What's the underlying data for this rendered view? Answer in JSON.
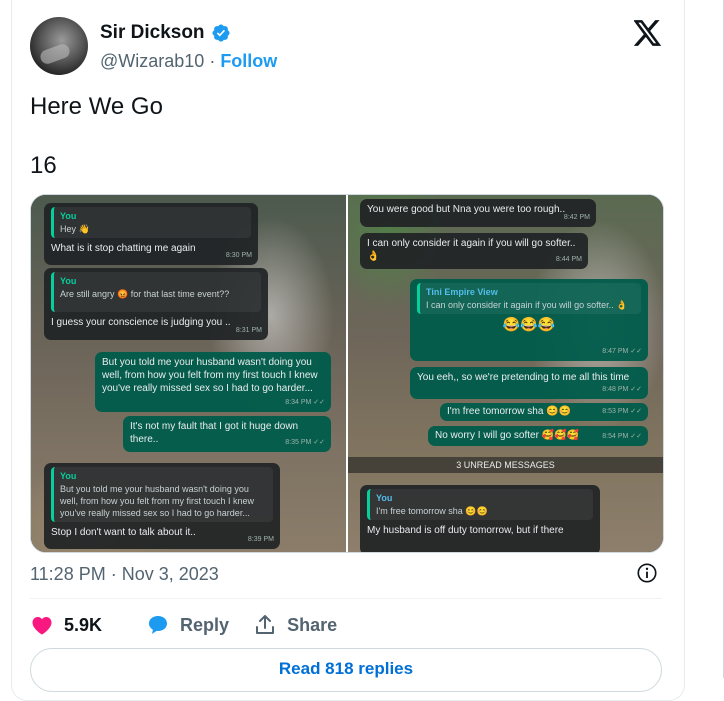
{
  "author": {
    "display_name": "Sir Dickson",
    "handle": "@Wizarab10",
    "separator": " · ",
    "follow_label": "Follow"
  },
  "tweet": {
    "text": "Here We Go",
    "number": "16",
    "timestamp": "11:28 PM · Nov 3, 2023"
  },
  "chat_left": {
    "m1": {
      "quote_name": "You",
      "quote_text": "Hey 👋",
      "text": "What is it stop chatting me again",
      "time": "8:30 PM"
    },
    "m2": {
      "quote_name": "You",
      "quote_text": "Are still angry 😡 for that last time event??",
      "text": "I guess your conscience is judging you ..",
      "time": "8:31 PM"
    },
    "m3": {
      "text": "But you told me your husband wasn't doing you well, from how you felt from my first touch I knew you've really missed sex so I had to go harder...",
      "time": "8:34 PM ✓✓"
    },
    "m4": {
      "text": "It's not my fault that I got it huge down there..",
      "time": "8:35 PM ✓✓"
    },
    "m5": {
      "quote_name": "You",
      "quote_text": "But you told me your husband wasn't doing you well, from how you felt from my first touch I knew you've really missed sex so I had to go harder...",
      "text": "Stop I don't want to talk about it..",
      "time": "8:39 PM"
    }
  },
  "chat_right": {
    "m1": {
      "text": "You were good but Nna you were too rough..",
      "time": "8:42 PM"
    },
    "m2": {
      "text": "I can only consider it again if you will go softer.. 👌",
      "time": "8:44 PM"
    },
    "m3": {
      "quote_name": "Tini Empire View",
      "quote_text": "I can only consider it again if you will go softer.. 👌",
      "text": "😂😂😂",
      "time": "8:47 PM ✓✓"
    },
    "m4": {
      "text": "You eeh,, so we're pretending to me all this time",
      "time": "8:48 PM ✓✓"
    },
    "m5": {
      "text": "I'm free tomorrow sha 😊😊",
      "time": "8:53 PM ✓✓"
    },
    "m6": {
      "text": "No worry I will go softer 🥰🥰🥰",
      "time": "8:54 PM ✓✓"
    },
    "unread": "3 UNREAD MESSAGES",
    "m7": {
      "quote_name": "You",
      "quote_text": "I'm free tomorrow sha 😊😊",
      "text": "My husband is off duty tomorrow, but if there"
    }
  },
  "actions": {
    "likes": "5.9K",
    "reply_label": "Reply",
    "share_label": "Share",
    "read_replies": "Read 818 replies"
  },
  "colors": {
    "accent": "#1d9bf0",
    "like": "#f91880",
    "reply_icon": "#1d9bf0",
    "whatsapp_sent": "#005c4b",
    "whatsapp_received": "#202426"
  },
  "icons": [
    "verified-badge-icon",
    "x-logo-icon",
    "info-icon",
    "heart-icon",
    "reply-bubble-icon",
    "share-icon"
  ]
}
